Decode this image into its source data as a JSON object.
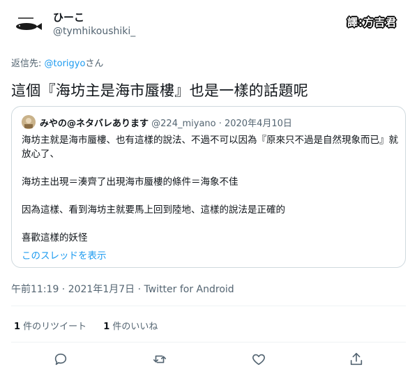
{
  "author": {
    "display_name": "ひーこ",
    "handle": "@tymhikoushiki_"
  },
  "badge": {
    "text": "譯:方吉君"
  },
  "reply": {
    "prefix": "返信先: ",
    "to": "@torigyo",
    "suffix": "さん"
  },
  "tweet": {
    "text": "這個『海坊主是海市蜃樓』也是一樣的話題呢",
    "timestamp": "午前11:19 · 2021年1月7日 · Twitter for Android"
  },
  "quote": {
    "name": "みやの@ネタバレあります",
    "handle_date": "@224_miyano · 2020年4月10日",
    "paragraphs": [
      "海坊主就是海市蜃樓、也有這樣的說法、不過不可以因為『原來只不過是自然現象而已』就放心了、",
      "海坊主出現＝湊齊了出現海市蜃樓的條件＝海象不佳",
      "因為這樣、看到海坊主就要馬上回到陸地、這樣的說法是正確的",
      "喜歡這樣的妖怪"
    ],
    "thread_link": "このスレッドを表示"
  },
  "stats": {
    "retweets_count": "1",
    "retweets_label": " 件のリツイート",
    "likes_count": "1",
    "likes_label": " 件のいいね"
  },
  "icons": {
    "reply": "reply-icon",
    "retweet": "retweet-icon",
    "like": "heart-icon",
    "share": "share-icon"
  },
  "colors": {
    "link": "#1d9bf0",
    "secondary_text": "#536471",
    "border": "#cfd9de"
  }
}
